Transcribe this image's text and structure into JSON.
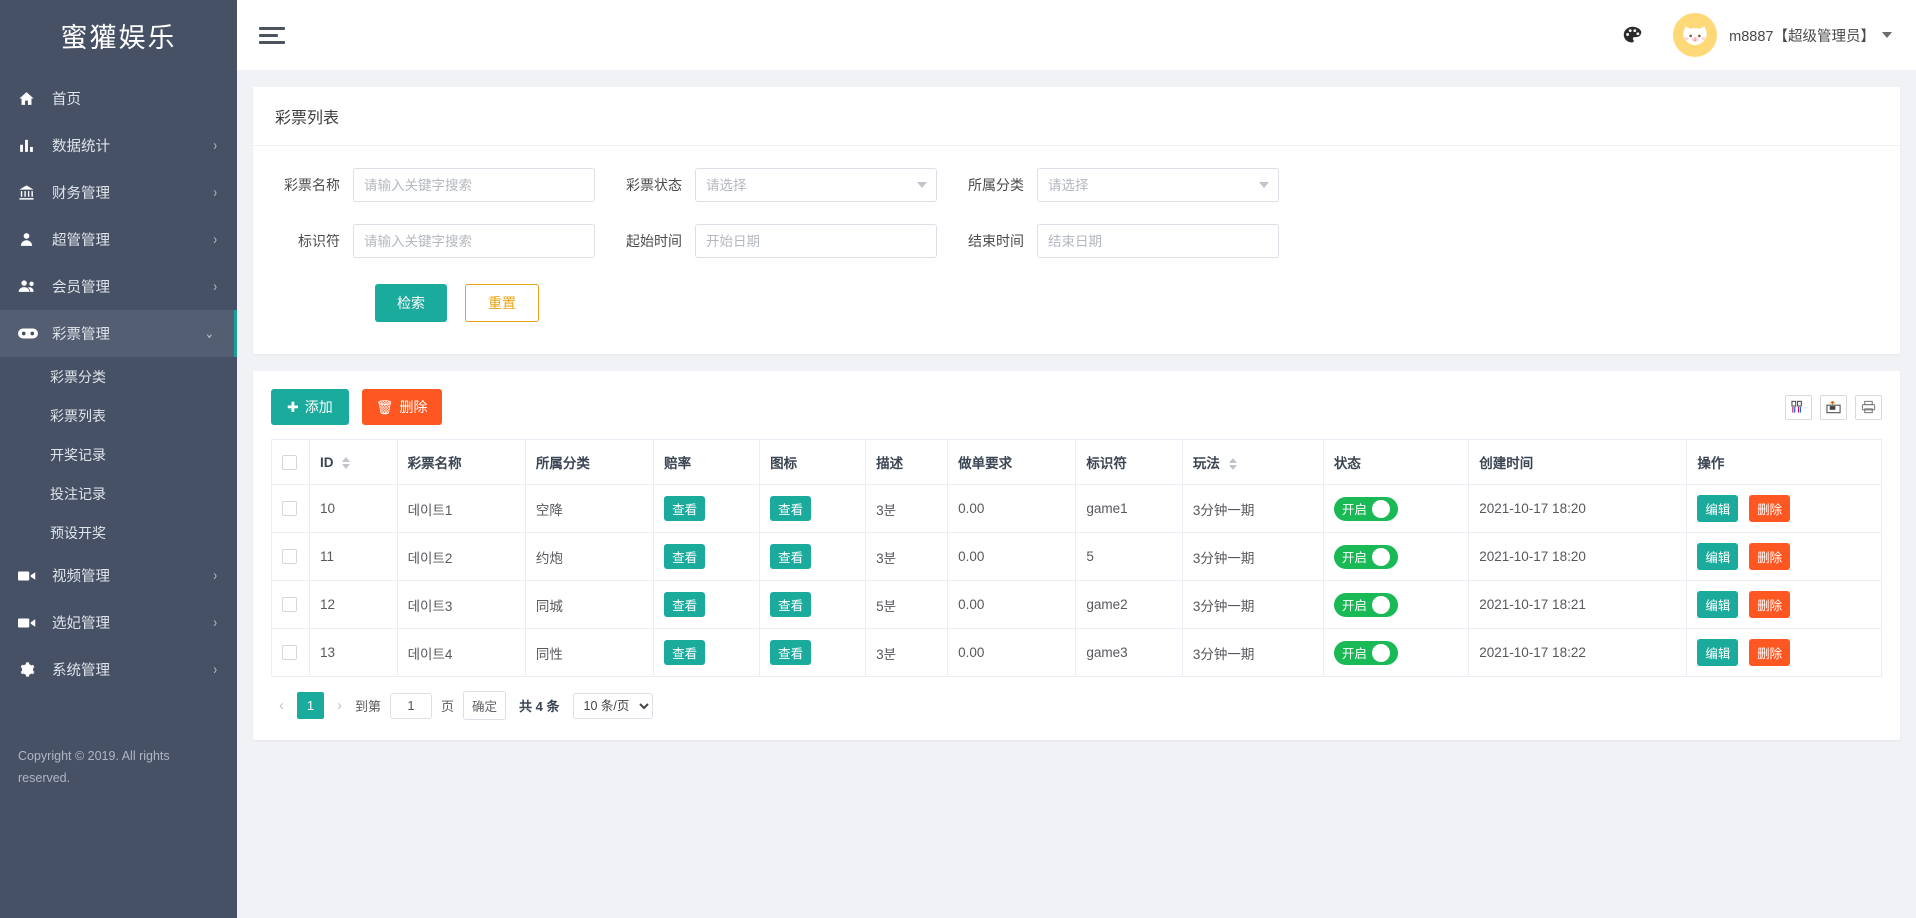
{
  "brand": {
    "title": "蜜獾娱乐"
  },
  "sidebar": {
    "items": [
      {
        "label": "首页",
        "icon": "home-icon",
        "arrow": ""
      },
      {
        "label": "数据统计",
        "icon": "bar-chart-icon",
        "arrow": "›"
      },
      {
        "label": "财务管理",
        "icon": "bank-icon",
        "arrow": "›"
      },
      {
        "label": "超管管理",
        "icon": "user-icon",
        "arrow": "›"
      },
      {
        "label": "会员管理",
        "icon": "users-icon",
        "arrow": "›"
      },
      {
        "label": "彩票管理",
        "icon": "gamepad-icon",
        "arrow": "⌄"
      },
      {
        "label": "视频管理",
        "icon": "video-icon",
        "arrow": "›"
      },
      {
        "label": "选妃管理",
        "icon": "video-icon",
        "arrow": "›"
      },
      {
        "label": "系统管理",
        "icon": "gear-icon",
        "arrow": "›"
      }
    ],
    "sub_items": [
      {
        "label": "彩票分类"
      },
      {
        "label": "彩票列表"
      },
      {
        "label": "开奖记录"
      },
      {
        "label": "投注记录"
      },
      {
        "label": "预设开奖"
      }
    ],
    "copyright": "Copyright © 2019. All rights reserved."
  },
  "topbar": {
    "username": "m8887【超级管理员】"
  },
  "search_card": {
    "title": "彩票列表",
    "fields": [
      {
        "label": "彩票名称",
        "placeholder": "请输入关键字搜索",
        "value": "",
        "type": "text"
      },
      {
        "label": "彩票状态",
        "placeholder": "请选择",
        "value": "",
        "type": "select"
      },
      {
        "label": "所属分类",
        "placeholder": "请选择",
        "value": "",
        "type": "select"
      },
      {
        "label": "标识符",
        "placeholder": "请输入关键字搜索",
        "value": "",
        "type": "text"
      },
      {
        "label": "起始时间",
        "placeholder": "开始日期",
        "value": "",
        "type": "date"
      },
      {
        "label": "结束时间",
        "placeholder": "结束日期",
        "value": "",
        "type": "date"
      }
    ],
    "search_button": "检索",
    "reset_button": "重置"
  },
  "table_card": {
    "add_button": "添加",
    "delete_button": "删除",
    "columns": [
      "ID",
      "彩票名称",
      "所属分类",
      "赔率",
      "图标",
      "描述",
      "做单要求",
      "标识符",
      "玩法",
      "状态",
      "创建时间",
      "操作"
    ],
    "rows": [
      {
        "id": "10",
        "name": "데이트1",
        "category": "空降",
        "odds": "查看",
        "icon": "查看",
        "desc": "3분",
        "requirement": "0.00",
        "flag": "game1",
        "play": "3分钟一期",
        "status": "开启",
        "created": "2021-10-17 18:20",
        "edit": "编辑",
        "del": "删除"
      },
      {
        "id": "11",
        "name": "데이트2",
        "category": "约炮",
        "odds": "查看",
        "icon": "查看",
        "desc": "3분",
        "requirement": "0.00",
        "flag": "5",
        "play": "3分钟一期",
        "status": "开启",
        "created": "2021-10-17 18:20",
        "edit": "编辑",
        "del": "删除"
      },
      {
        "id": "12",
        "name": "데이트3",
        "category": "同城",
        "odds": "查看",
        "icon": "查看",
        "desc": "5분",
        "requirement": "0.00",
        "flag": "game2",
        "play": "3分钟一期",
        "status": "开启",
        "created": "2021-10-17 18:21",
        "edit": "编辑",
        "del": "删除"
      },
      {
        "id": "13",
        "name": "데이트4",
        "category": "同性",
        "odds": "查看",
        "icon": "查看",
        "desc": "3분",
        "requirement": "0.00",
        "flag": "game3",
        "play": "3分钟一期",
        "status": "开启",
        "created": "2021-10-17 18:22",
        "edit": "编辑",
        "del": "删除"
      }
    ],
    "pager": {
      "prev": "‹",
      "current_page": "1",
      "next": "›",
      "goto_label": "到第",
      "goto_value": "1",
      "page_label": "页",
      "confirm": "确定",
      "total": "共 4 条",
      "page_size": "10 条/页"
    }
  },
  "colors": {
    "sidebar_bg": "#475165",
    "accent_teal": "#1bab9c",
    "danger": "#ff5722",
    "switch_green": "#19b955",
    "warning": "#e8a317"
  }
}
